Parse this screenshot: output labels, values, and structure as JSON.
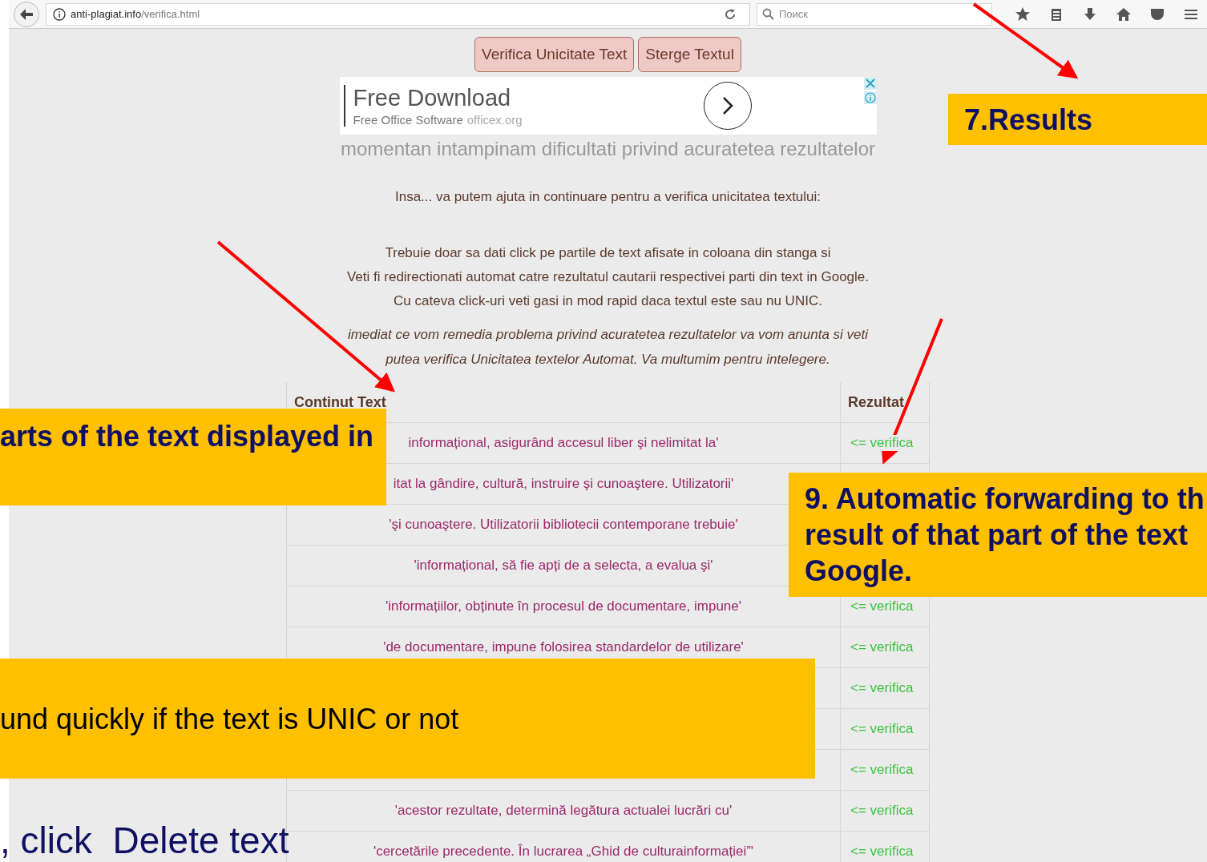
{
  "browser": {
    "url_host": "anti-plagiat.info",
    "url_path": "/verifica.html",
    "search": {
      "placeholder": "Поиск"
    }
  },
  "buttons": [
    {
      "label": "Verifica Unicitate Text"
    },
    {
      "label": "Sterge Textul"
    }
  ],
  "ad": {
    "title": "Free Download",
    "subtitle": "Free Office Software",
    "domain": "officex.org"
  },
  "notice": "momentan intampinam dificultati privind acuratetea rezultatelor",
  "intro": "Insa... va putem ajuta in continuare pentru a verifica unicitatea textului:",
  "instructions": [
    "Trebuie doar sa dati click pe partile de text afisate in coloana din stanga si",
    "Veti fi redirectionati automat catre rezultatul cautarii respectivei parti din text in Google.",
    "Cu cateva click-uri veti gasi in mod rapid daca textul este sau nu UNIC."
  ],
  "italic_note": [
    "imediat ce vom remedia problema privind acuratetea rezultatelor va vom anunta si veti",
    "putea verifica Unicitatea textelor Automat. Va multumim pentru intelegere."
  ],
  "table": {
    "columns": [
      "Continut Text",
      "Rezultat"
    ],
    "rows": [
      {
        "text": "informațional, asigurând accesul liber şi nelimitat la'",
        "result": "<= verifica"
      },
      {
        "text": "itat la gândire, cultură, instruire şi cunoaştere. Utilizatorii'"
      },
      {
        "text": "'şi cunoaştere. Utilizatorii bibliotecii contemporane trebuie'"
      },
      {
        "text": "'informațional, să fie apți de a selecta, a evalua şi'"
      },
      {
        "text": "'informațiilor, obținute în procesul de documentare, impune'",
        "result": "<= verifica"
      },
      {
        "text": "'de documentare, impune folosirea standardelor de utilizare'",
        "result": "<= verifica"
      },
      {
        "result": "<= verifica"
      },
      {
        "result": "<= verifica"
      },
      {
        "result": "<= verifica"
      },
      {
        "text": "'acestor rezultate, determină legătura actualei lucrări cu'",
        "result": "<= verifica"
      },
      {
        "text": "'cercetările precedente. În lucrarea „Ghid de culturainformației”'",
        "result": "<= verifica"
      }
    ]
  },
  "callouts": [
    {
      "kind": "bold",
      "lines": [
        "7.Results"
      ]
    },
    {
      "kind": "bold",
      "lines": [
        "arts of the text displayed in"
      ]
    },
    {
      "kind": "bold",
      "lines": [
        "9. Automatic forwarding to th",
        "result of that part of the text",
        "Google."
      ]
    },
    {
      "kind": "plain",
      "lines": [
        "und quickly if the text is UNIC or not"
      ]
    }
  ],
  "caption": ", click  Delete text"
}
